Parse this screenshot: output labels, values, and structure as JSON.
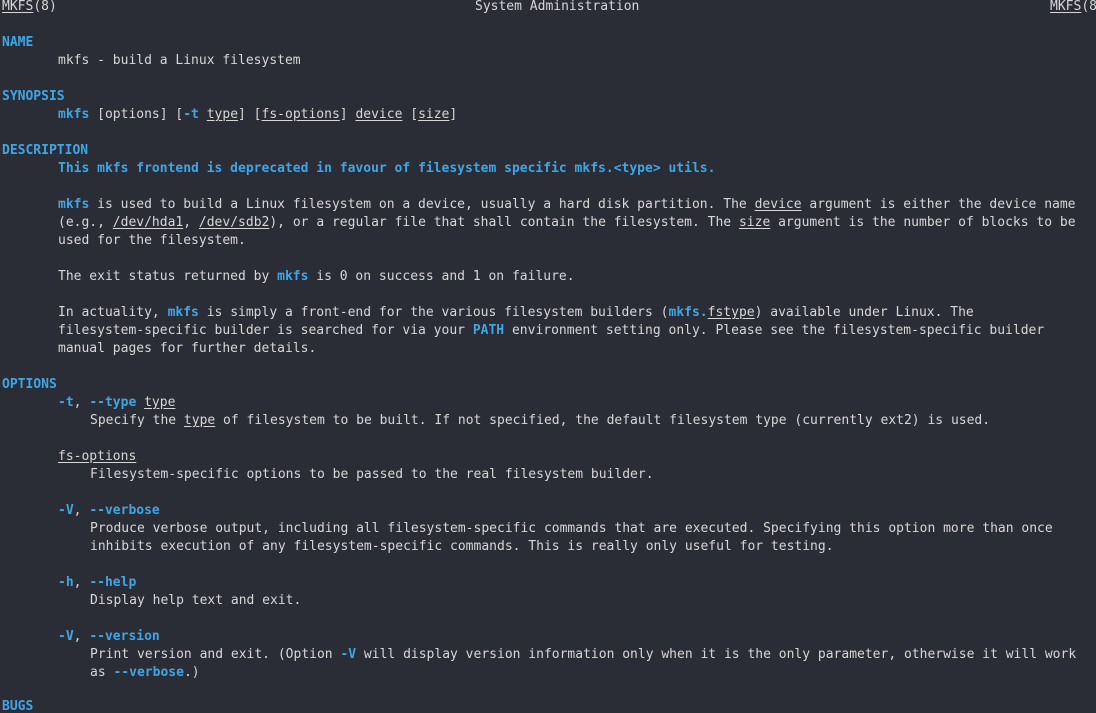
{
  "colors": {
    "background": "#2b2d36",
    "text": "#d7d7d7",
    "bold": "#3fa6e6"
  },
  "header": {
    "left": "MKFS",
    "left_suffix": "(8)",
    "center": "System Administration",
    "right": "MKFS",
    "right_suffix": "(8"
  },
  "name": {
    "heading": "NAME",
    "text": "mkfs - build a Linux filesystem"
  },
  "synopsis": {
    "heading": "SYNOPSIS",
    "cmd": "mkfs",
    "options": " [options] [",
    "t_flag": "-t",
    "type": "type",
    "close_open": "] [",
    "fs_options": "fs-options",
    "close_space": "] ",
    "device": "device",
    "open": " [",
    "size": "size",
    "close": "]"
  },
  "description": {
    "heading": "DESCRIPTION",
    "deprecated": "This mkfs frontend is deprecated in favour of filesystem specific mkfs.<type> utils.",
    "p1_cmd": "mkfs",
    "p1_a": " is used to build a Linux filesystem on a device, usually a hard disk partition. The ",
    "p1_device": "device",
    "p1_b": " argument is either the device name",
    "p1_c": "(e.g., ",
    "p1_hda1": "/dev/hda1",
    "p1_comma": ", ",
    "p1_sdb2": "/dev/sdb2",
    "p1_d": "), or a regular file that shall contain the filesystem. The ",
    "p1_size": "size",
    "p1_e": " argument is the number of blocks to be",
    "p1_f": "used for the filesystem.",
    "p2_a": "The exit status returned by ",
    "p2_cmd": "mkfs",
    "p2_b": " is 0 on success and 1 on failure.",
    "p3_a": "In actuality, ",
    "p3_cmd": "mkfs",
    "p3_b": " is simply a front-end for the various filesystem builders (",
    "p3_mkfs": "mkfs.",
    "p3_fstype": "fstype",
    "p3_c": ") available under Linux. The",
    "p3_d": "filesystem-specific builder is searched for via your ",
    "p3_path": "PATH",
    "p3_e": " environment setting only. Please see the filesystem-specific builder",
    "p3_f": "manual pages for further details."
  },
  "options": {
    "heading": "OPTIONS",
    "t_short": "-t",
    "t_sep": ", ",
    "t_long": "--type",
    "t_arg": "type",
    "t_desc_a": "Specify the ",
    "t_desc_type": "type",
    "t_desc_b": " of filesystem to be built. If not specified, the default filesystem type (currently ext2) is used.",
    "fs_options": "fs-options",
    "fs_desc": "Filesystem-specific options to be passed to the real filesystem builder.",
    "v_short": "-V",
    "v_sep": ", ",
    "v_long": "--verbose",
    "v_desc1": "Produce verbose output, including all filesystem-specific commands that are executed. Specifying this option more than once",
    "v_desc2": "inhibits execution of any filesystem-specific commands. This is really only useful for testing.",
    "h_short": "-h",
    "h_sep": ", ",
    "h_long": "--help",
    "h_desc": "Display help text and exit.",
    "ver_short": "-V",
    "ver_sep": ", ",
    "ver_long": "--version",
    "ver_desc_a": "Print version and exit. (Option ",
    "ver_desc_v": "-V",
    "ver_desc_b": " will display version information only when it is the only parameter, otherwise it will work",
    "ver_desc_c": "as ",
    "ver_desc_verbose": "--verbose",
    "ver_desc_d": ".)"
  },
  "bugs": {
    "heading": "BUGS"
  }
}
